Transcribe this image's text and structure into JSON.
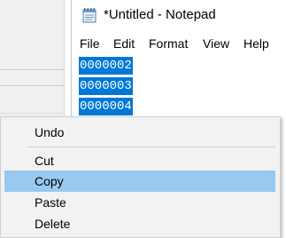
{
  "notepad": {
    "title": "*Untitled - Notepad",
    "menu": [
      "File",
      "Edit",
      "Format",
      "View",
      "Help"
    ],
    "selected_lines": [
      "0000002",
      "0000003",
      "0000004"
    ],
    "selection_color": "#0078d7"
  },
  "context_menu": {
    "items": [
      "Undo",
      "Cut",
      "Copy",
      "Paste",
      "Delete"
    ],
    "highlighted": "Copy",
    "highlight_color": "#99c9f0"
  }
}
